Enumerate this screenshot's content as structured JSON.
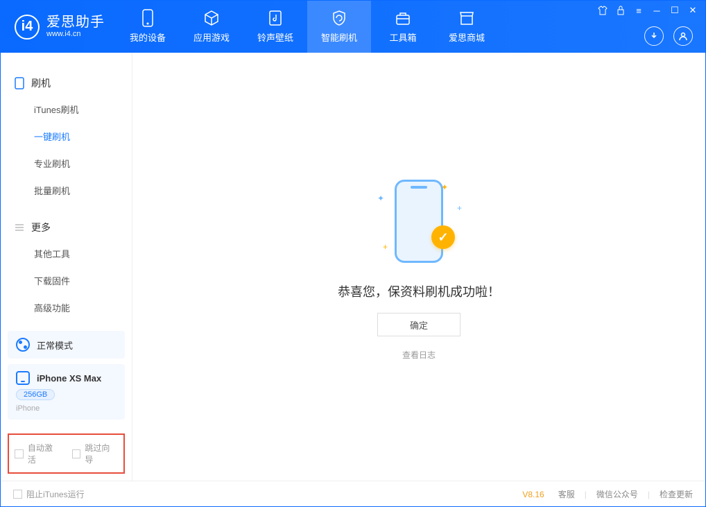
{
  "app": {
    "name": "爱思助手",
    "domain": "www.i4.cn"
  },
  "tabs": [
    {
      "label": "我的设备"
    },
    {
      "label": "应用游戏"
    },
    {
      "label": "铃声壁纸"
    },
    {
      "label": "智能刷机"
    },
    {
      "label": "工具箱"
    },
    {
      "label": "爱思商城"
    }
  ],
  "sidebar": {
    "section1": {
      "title": "刷机",
      "items": [
        "iTunes刷机",
        "一键刷机",
        "专业刷机",
        "批量刷机"
      ]
    },
    "section2": {
      "title": "更多",
      "items": [
        "其他工具",
        "下载固件",
        "高级功能"
      ]
    },
    "mode": "正常模式",
    "device": {
      "name": "iPhone XS Max",
      "storage": "256GB",
      "type": "iPhone"
    },
    "opts": {
      "auto_activate": "自动激活",
      "skip_guide": "跳过向导"
    }
  },
  "main": {
    "success_msg": "恭喜您，保资料刷机成功啦！",
    "ok": "确定",
    "view_log": "查看日志"
  },
  "footer": {
    "block_itunes": "阻止iTunes运行",
    "version": "V8.16",
    "links": [
      "客服",
      "微信公众号",
      "检查更新"
    ]
  }
}
